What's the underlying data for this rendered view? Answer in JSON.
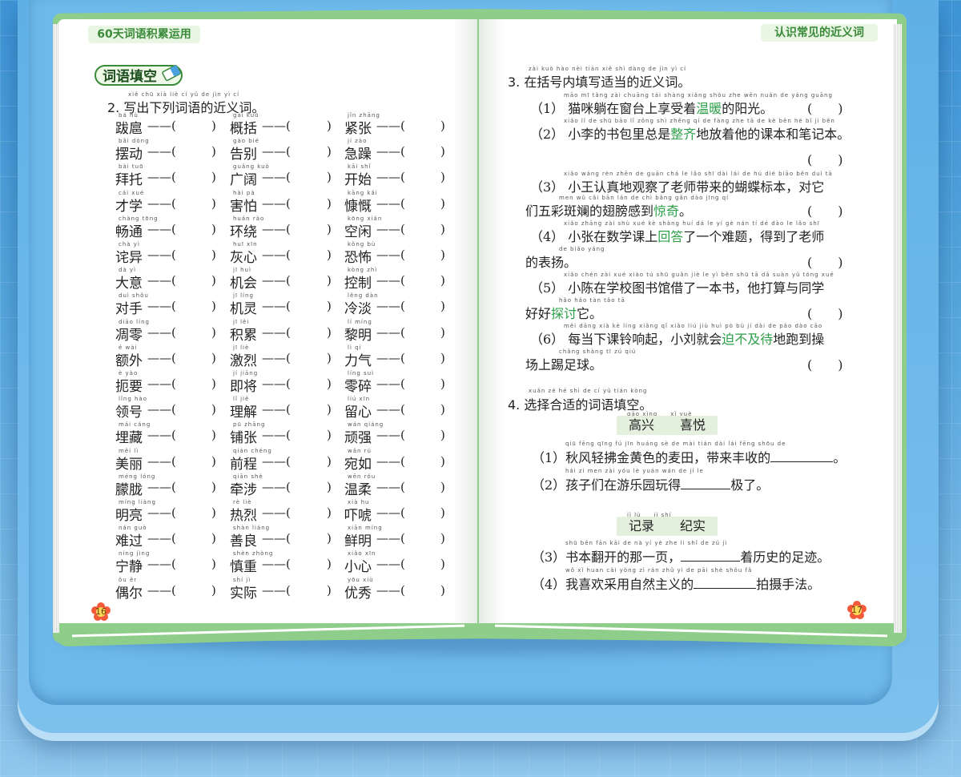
{
  "header": {
    "left_title": "60天词语积累运用",
    "right_title": "认识常见的近义词"
  },
  "left_page": {
    "section_tag": "词语填空",
    "question2": {
      "pinyin": "xiě chū xià liè cí yǔ de jìn yì cí",
      "title": "2. 写出下列词语的近义词。"
    },
    "columns": [
      [
        {
          "py": "bá hù",
          "w": "跋扈"
        },
        {
          "py": "bǎi dòng",
          "w": "摆动"
        },
        {
          "py": "bài tuō",
          "w": "拜托"
        },
        {
          "py": "cái xué",
          "w": "才学"
        },
        {
          "py": "chàng tōng",
          "w": "畅通"
        },
        {
          "py": "chà yì",
          "w": "诧异"
        },
        {
          "py": "dà yì",
          "w": "大意"
        },
        {
          "py": "duì shǒu",
          "w": "对手"
        },
        {
          "py": "diāo líng",
          "w": "凋零"
        },
        {
          "py": "é wài",
          "w": "额外"
        },
        {
          "py": "è yào",
          "w": "扼要"
        },
        {
          "py": "lǐng hào",
          "w": "领号"
        },
        {
          "py": "mái cáng",
          "w": "埋藏"
        },
        {
          "py": "měi lì",
          "w": "美丽"
        },
        {
          "py": "méng lóng",
          "w": "朦胧"
        },
        {
          "py": "míng liàng",
          "w": "明亮"
        },
        {
          "py": "nán guò",
          "w": "难过"
        },
        {
          "py": "níng jìng",
          "w": "宁静"
        },
        {
          "py": "ǒu ěr",
          "w": "偶尔"
        }
      ],
      [
        {
          "py": "gài kuò",
          "w": "概括"
        },
        {
          "py": "gào bié",
          "w": "告别"
        },
        {
          "py": "guǎng kuò",
          "w": "广阔"
        },
        {
          "py": "hài pà",
          "w": "害怕"
        },
        {
          "py": "huán rào",
          "w": "环绕"
        },
        {
          "py": "huī xīn",
          "w": "灰心"
        },
        {
          "py": "jī huì",
          "w": "机会"
        },
        {
          "py": "jī líng",
          "w": "机灵"
        },
        {
          "py": "jī lěi",
          "w": "积累"
        },
        {
          "py": "jī liè",
          "w": "激烈"
        },
        {
          "py": "jí jiāng",
          "w": "即将"
        },
        {
          "py": "lǐ jiě",
          "w": "理解"
        },
        {
          "py": "pū zhāng",
          "w": "铺张"
        },
        {
          "py": "qián chéng",
          "w": "前程"
        },
        {
          "py": "qiān shè",
          "w": "牵涉"
        },
        {
          "py": "rè liè",
          "w": "热烈"
        },
        {
          "py": "shàn liáng",
          "w": "善良"
        },
        {
          "py": "shèn zhòng",
          "w": "慎重"
        },
        {
          "py": "shí jì",
          "w": "实际"
        }
      ],
      [
        {
          "py": "jǐn zhāng",
          "w": "紧张"
        },
        {
          "py": "jí zào",
          "w": "急躁"
        },
        {
          "py": "kāi shǐ",
          "w": "开始"
        },
        {
          "py": "kāng kǎi",
          "w": "慷慨"
        },
        {
          "py": "kōng xián",
          "w": "空闲"
        },
        {
          "py": "kǒng bù",
          "w": "恐怖"
        },
        {
          "py": "kòng zhì",
          "w": "控制"
        },
        {
          "py": "lěng dàn",
          "w": "冷淡"
        },
        {
          "py": "lí míng",
          "w": "黎明"
        },
        {
          "py": "lì qi",
          "w": "力气"
        },
        {
          "py": "líng suì",
          "w": "零碎"
        },
        {
          "py": "liú xīn",
          "w": "留心"
        },
        {
          "py": "wán qiáng",
          "w": "顽强"
        },
        {
          "py": "wǎn rú",
          "w": "宛如"
        },
        {
          "py": "wēn róu",
          "w": "温柔"
        },
        {
          "py": "xià hu",
          "w": "吓唬"
        },
        {
          "py": "xiān míng",
          "w": "鲜明"
        },
        {
          "py": "xiǎo xīn",
          "w": "小心"
        },
        {
          "py": "yōu xiù",
          "w": "优秀"
        }
      ]
    ],
    "dash": "——(",
    "close_paren": ")",
    "page_number": "16"
  },
  "right_page": {
    "question3": {
      "pinyin": "zài kuò hào nèi tián xiě shì dàng de jìn yì cí",
      "title": "3. 在括号内填写适当的近义词。",
      "items": [
        {
          "lines": [
            {
              "py": "māo mī tǎng zài chuāng tái shàng xiǎng shòu zhe wēn nuǎn de yáng guāng",
              "pre": "（1） 猫咪躺在窗台上享受着",
              "hl": "温暖",
              "post": "的阳光。",
              "paren": "(　　)"
            }
          ]
        },
        {
          "lines": [
            {
              "py": "xiǎo lǐ de shū bāo lǐ zǒng shì zhěng qí de fàng zhe tā de kè běn hé bǐ jì běn",
              "pre": "（2） 小李的书包里总是",
              "hl": "整齐",
              "post": "地放着他的课本和笔记本。",
              "paren": ""
            },
            {
              "py": "",
              "pre": "",
              "hl": "",
              "post": "",
              "paren": "(　　)"
            }
          ]
        },
        {
          "lines": [
            {
              "py": "xiǎo wáng rèn zhēn de guān chá le lǎo shī dài lái de hú dié biāo běn duì tā",
              "pre": "（3） 小王认真地观察了老师带来的蝴蝶标本，对它",
              "hl": "",
              "post": "",
              "paren": ""
            },
            {
              "py": "men wǔ cǎi bān lán de chì bǎng gǎn dào jīng qí",
              "pre": "们五彩斑斓的翅膀感到",
              "hl": "惊奇",
              "post": "。",
              "paren": "(　　)"
            }
          ]
        },
        {
          "lines": [
            {
              "py": "xiǎo zhāng zài shù xué kè shàng huí dá le yí gè nán tí dé dào le lǎo shī",
              "pre": "（4） 小张在数学课上",
              "hl": "回答",
              "post": "了一个难题，得到了老师",
              "paren": ""
            },
            {
              "py": "de biǎo yáng",
              "pre": "的表扬。",
              "hl": "",
              "post": "",
              "paren": "(　　)"
            }
          ]
        },
        {
          "lines": [
            {
              "py": "xiǎo chén zài xué xiào tú shū guǎn jiè le yì běn shū tā dǎ suàn yǔ tóng xué",
              "pre": "（5） 小陈在学校图书馆借了一本书，他打算与同学",
              "hl": "",
              "post": "",
              "paren": ""
            },
            {
              "py": "hǎo hǎo tàn tǎo tā",
              "pre": "好好",
              "hl": "探讨",
              "post": "它。",
              "paren": "(　　)"
            }
          ]
        },
        {
          "lines": [
            {
              "py": "měi dāng xià kè líng xiǎng qǐ xiǎo liú jiù huì pò bù jí dài de pǎo dào cāo",
              "pre": "（6） 每当下课铃响起，小刘就会",
              "hl": "迫不及待",
              "post": "地跑到操",
              "paren": ""
            },
            {
              "py": "chǎng shàng tī zú qiú",
              "pre": "场上踢足球。",
              "hl": "",
              "post": "",
              "paren": "(　　)"
            }
          ]
        }
      ]
    },
    "question4": {
      "pinyin": "xuǎn zé hé shì de cí yǔ tián kòng",
      "title": "4. 选择合适的词语填空。",
      "group1": {
        "box_py": "gāo xìng　　xǐ yuè",
        "box": "高兴　　喜悦",
        "items": [
          {
            "py": "qiū fēng qīng fú jīn huáng sè de mài tián dài lái fēng shōu de",
            "pre": "（1）秋风轻拂金黄色的麦田，带来丰收的",
            "post": "。"
          },
          {
            "py": "hái zi men zài yóu lè yuán wán de jí le",
            "pre": "（2）孩子们在游乐园玩得",
            "post": "极了。"
          }
        ]
      },
      "group2": {
        "box_py": "jì lù　　jì shí",
        "box": "记录　　纪实",
        "items": [
          {
            "py": "shū běn fān kāi de nà yí yè zhe lì shǐ de zú jì",
            "pre": "（3）书本翻开的那一页，",
            "post": "着历史的足迹。"
          },
          {
            "py": "wǒ xǐ huan cǎi yòng zì rán zhǔ yì de pāi shè shǒu fǎ",
            "pre": "（4）我喜欢采用自然主义的",
            "post": "拍摄手法。"
          }
        ]
      }
    },
    "page_number": "17"
  },
  "colors": {
    "background": "#4a9fdc",
    "page_border": "#8fce8a",
    "highlight": "#2ea04a",
    "word_box": "#e3f0de"
  }
}
